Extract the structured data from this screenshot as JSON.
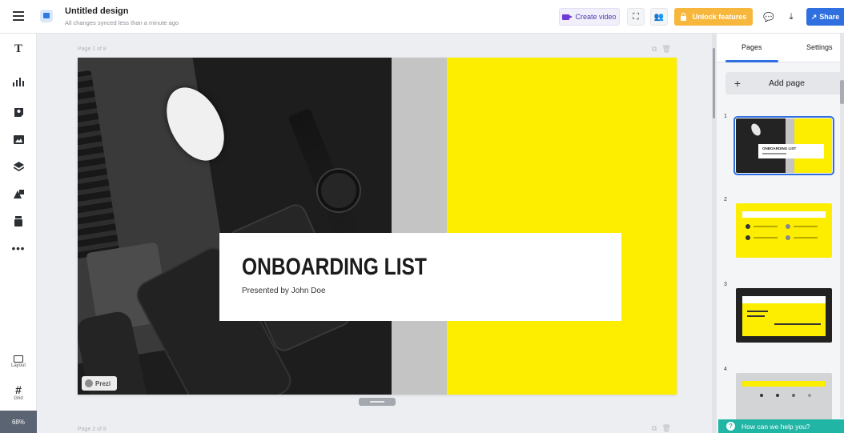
{
  "header": {
    "title": "Untitled design",
    "status": "All changes synced less than a minute ago",
    "create_video": "Create video",
    "unlock": "Unlock features",
    "share": "Share"
  },
  "toolbar": {
    "text_glyph": "T",
    "more_glyph": "•••",
    "layout_label": "Layout",
    "grid_label": "Grid",
    "zoom": "68%"
  },
  "canvas": {
    "page_label": "Page 1 of 8",
    "next_page_label": "Page 2 of 8",
    "slide_title": "ONBOARDING LIST",
    "slide_subtitle": "Presented by John Doe",
    "badge": "Prezi"
  },
  "panel": {
    "tabs": [
      "Pages",
      "Settings"
    ],
    "add_page": "Add page",
    "thumbnails": [
      {
        "number": "1",
        "title": "ONBOARDING LIST"
      },
      {
        "number": "2"
      },
      {
        "number": "3"
      },
      {
        "number": "4"
      }
    ]
  },
  "help": "How can we help you?",
  "colors": {
    "accent_yellow": "#fdee00",
    "primary_blue": "#2f6fe0",
    "unlock_orange": "#f6b73c",
    "help_teal": "#21b5a6"
  }
}
